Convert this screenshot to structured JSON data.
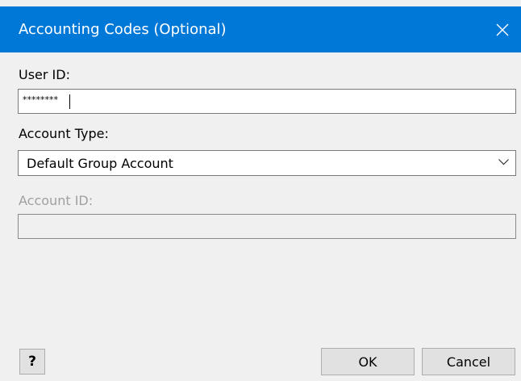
{
  "window": {
    "title": "Accounting Codes (Optional)",
    "close_icon": "close-icon",
    "accent_color": "#0078d7"
  },
  "user_id": {
    "label": "User ID:",
    "value": "********"
  },
  "account_type": {
    "label": "Account Type:",
    "selected": "Default Group Account",
    "dropdown_icon": "chevron-down-icon"
  },
  "account_id": {
    "label": "Account ID:",
    "value": "",
    "disabled": true
  },
  "buttons": {
    "help_label": "?",
    "ok_label": "OK",
    "cancel_label": "Cancel"
  }
}
